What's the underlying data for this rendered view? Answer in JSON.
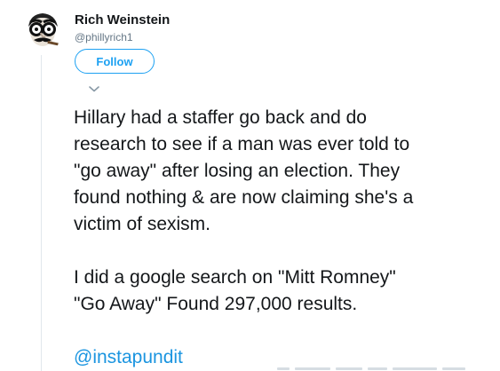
{
  "author": {
    "display_name": "Rich Weinstein",
    "screen_name": "@phillyrich1",
    "avatar_icon": "avatar-glasses-icon"
  },
  "actions": {
    "follow_label": "Follow",
    "menu_icon": "chevron-down-icon"
  },
  "tweet": {
    "paragraph_1_lines": [
      "Hillary had a staffer go back and do",
      "research to see if a man was ever told to",
      "\"go away\" after losing an election. They",
      "found nothing & are now claiming she's a",
      "victim of sexism."
    ],
    "paragraph_2_lines": [
      "I did a google search on \"Mitt Romney\"",
      "\"Go Away\"  Found 297,000 results."
    ],
    "mention": "@instapundit"
  },
  "colors": {
    "accent": "#1da1f2",
    "link": "#1b95e0",
    "text": "#14171a",
    "secondary_text": "#657786",
    "divider": "#e1e8ed"
  }
}
